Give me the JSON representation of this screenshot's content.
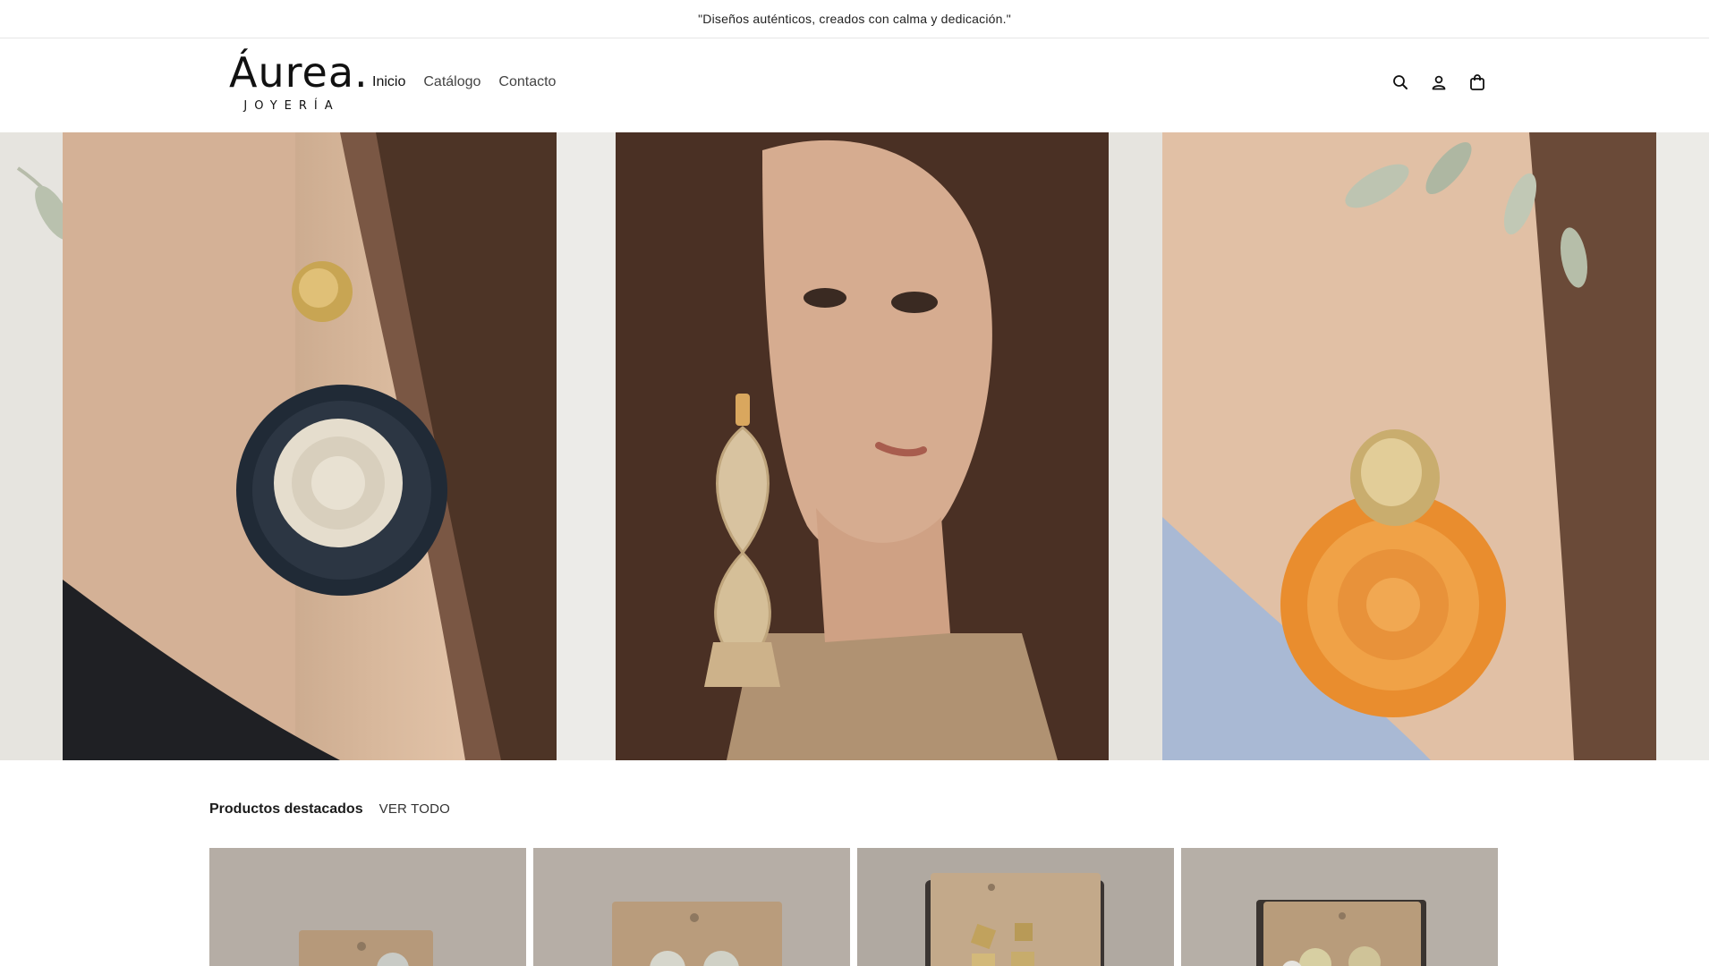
{
  "announcement": {
    "text": "\"Diseños auténticos, creados con calma y dedicación.\""
  },
  "logo": {
    "main": "Áurea.",
    "sub": "JOYERÍA"
  },
  "nav": {
    "items": [
      "Inicio",
      "Catálogo",
      "Contacto"
    ],
    "active": "Inicio"
  },
  "header_icons": [
    "search-icon",
    "account-icon",
    "cart-icon"
  ],
  "hero": {
    "panels": [
      "earring-black-white",
      "earring-raffia-drop",
      "earring-orange-gold"
    ]
  },
  "featured": {
    "title": "Productos destacados",
    "view_all": "VER TODO"
  },
  "products": [
    {
      "id": "product-1"
    },
    {
      "id": "product-2"
    },
    {
      "id": "product-3"
    },
    {
      "id": "product-4"
    }
  ],
  "colors": {
    "text": "#1c1c1c",
    "background": "#ffffff",
    "border": "#e6e6e6",
    "hero_bg": "#ecebe7"
  }
}
